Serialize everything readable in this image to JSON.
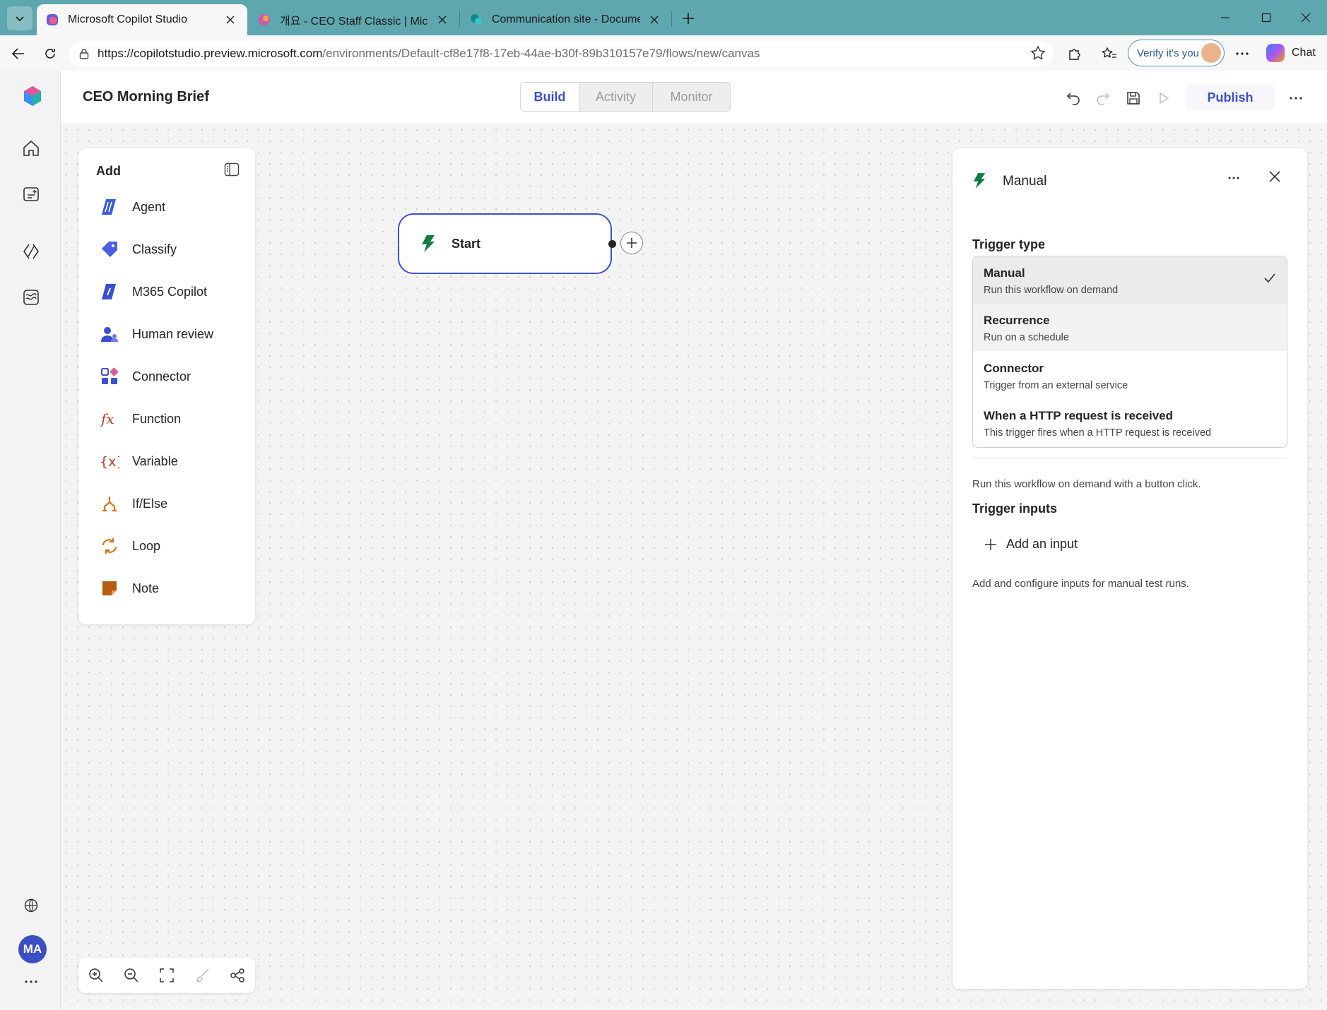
{
  "browser": {
    "tabs": [
      {
        "title": "Microsoft Copilot Studio",
        "active": true
      },
      {
        "title": "개요 - CEO Staff Classic | Microsoft",
        "active": false
      },
      {
        "title": "Communication site - Documents",
        "active": false
      }
    ],
    "url_host": "https://copilotstudio.preview.microsoft.com",
    "url_path": "/environments/Default-cf8e17f8-17eb-44ae-b30f-89b310157e79/flows/new/canvas",
    "verify_label": "Verify it's you",
    "chat_label": "Chat"
  },
  "app": {
    "title": "CEO Morning Brief",
    "modes": {
      "build": "Build",
      "activity": "Activity",
      "monitor": "Monitor"
    },
    "publish_label": "Publish",
    "avatar_initials": "MA",
    "accent": "#3a4fd1"
  },
  "add_panel": {
    "title": "Add",
    "items": [
      {
        "label": "Agent",
        "icon": "agent-icon"
      },
      {
        "label": "Classify",
        "icon": "tag-icon"
      },
      {
        "label": "M365 Copilot",
        "icon": "copilot-icon"
      },
      {
        "label": "Human review",
        "icon": "people-icon"
      },
      {
        "label": "Connector",
        "icon": "apps-icon"
      },
      {
        "label": "Function",
        "icon": "function-icon"
      },
      {
        "label": "Variable",
        "icon": "variable-icon"
      },
      {
        "label": "If/Else",
        "icon": "branch-icon"
      },
      {
        "label": "Loop",
        "icon": "loop-icon"
      },
      {
        "label": "Note",
        "icon": "note-icon"
      }
    ]
  },
  "canvas": {
    "start_node_label": "Start"
  },
  "properties": {
    "title": "Manual",
    "trigger_type_label": "Trigger type",
    "options": [
      {
        "title": "Manual",
        "desc": "Run this workflow on demand",
        "selected": true
      },
      {
        "title": "Recurrence",
        "desc": "Run on a schedule",
        "selected": false
      },
      {
        "title": "Connector",
        "desc": "Trigger from an external service",
        "selected": false
      },
      {
        "title": "When a HTTP request is received",
        "desc": "This trigger fires when a HTTP request is received",
        "selected": false
      }
    ],
    "description": "Run this workflow on demand with a button click.",
    "trigger_inputs_label": "Trigger inputs",
    "add_input_label": "Add an input",
    "inputs_hint": "Add and configure inputs for manual test runs."
  }
}
